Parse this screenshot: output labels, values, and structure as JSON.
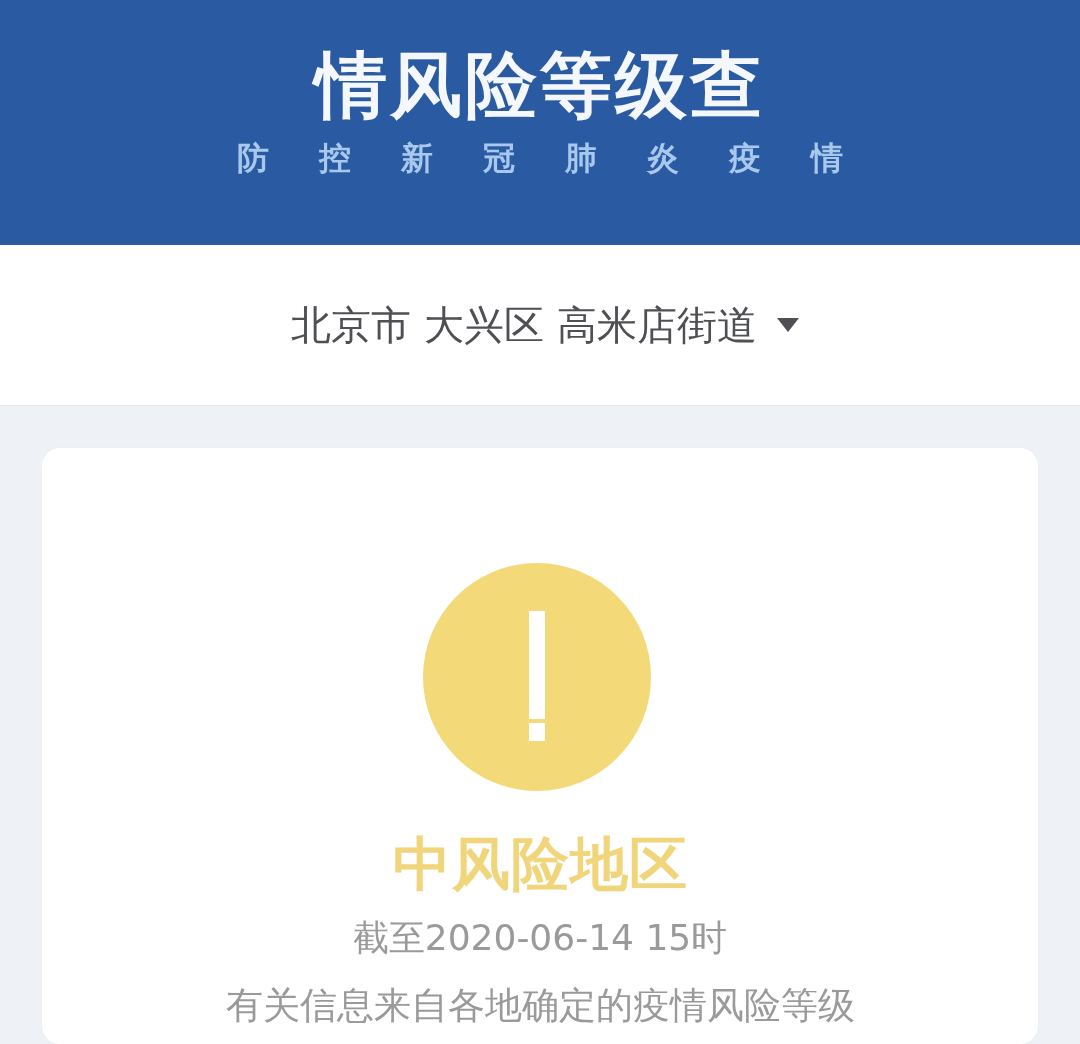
{
  "header": {
    "title": "情风险等级查",
    "subtitle": "防控新冠肺炎疫情"
  },
  "location": {
    "value": "北京市 大兴区 高米店街道"
  },
  "result": {
    "kind": "medium",
    "status": "中风险地区",
    "updated": "截至2020-06-14 15时",
    "note": "有关信息来自各地确定的疫情风险等级"
  }
}
